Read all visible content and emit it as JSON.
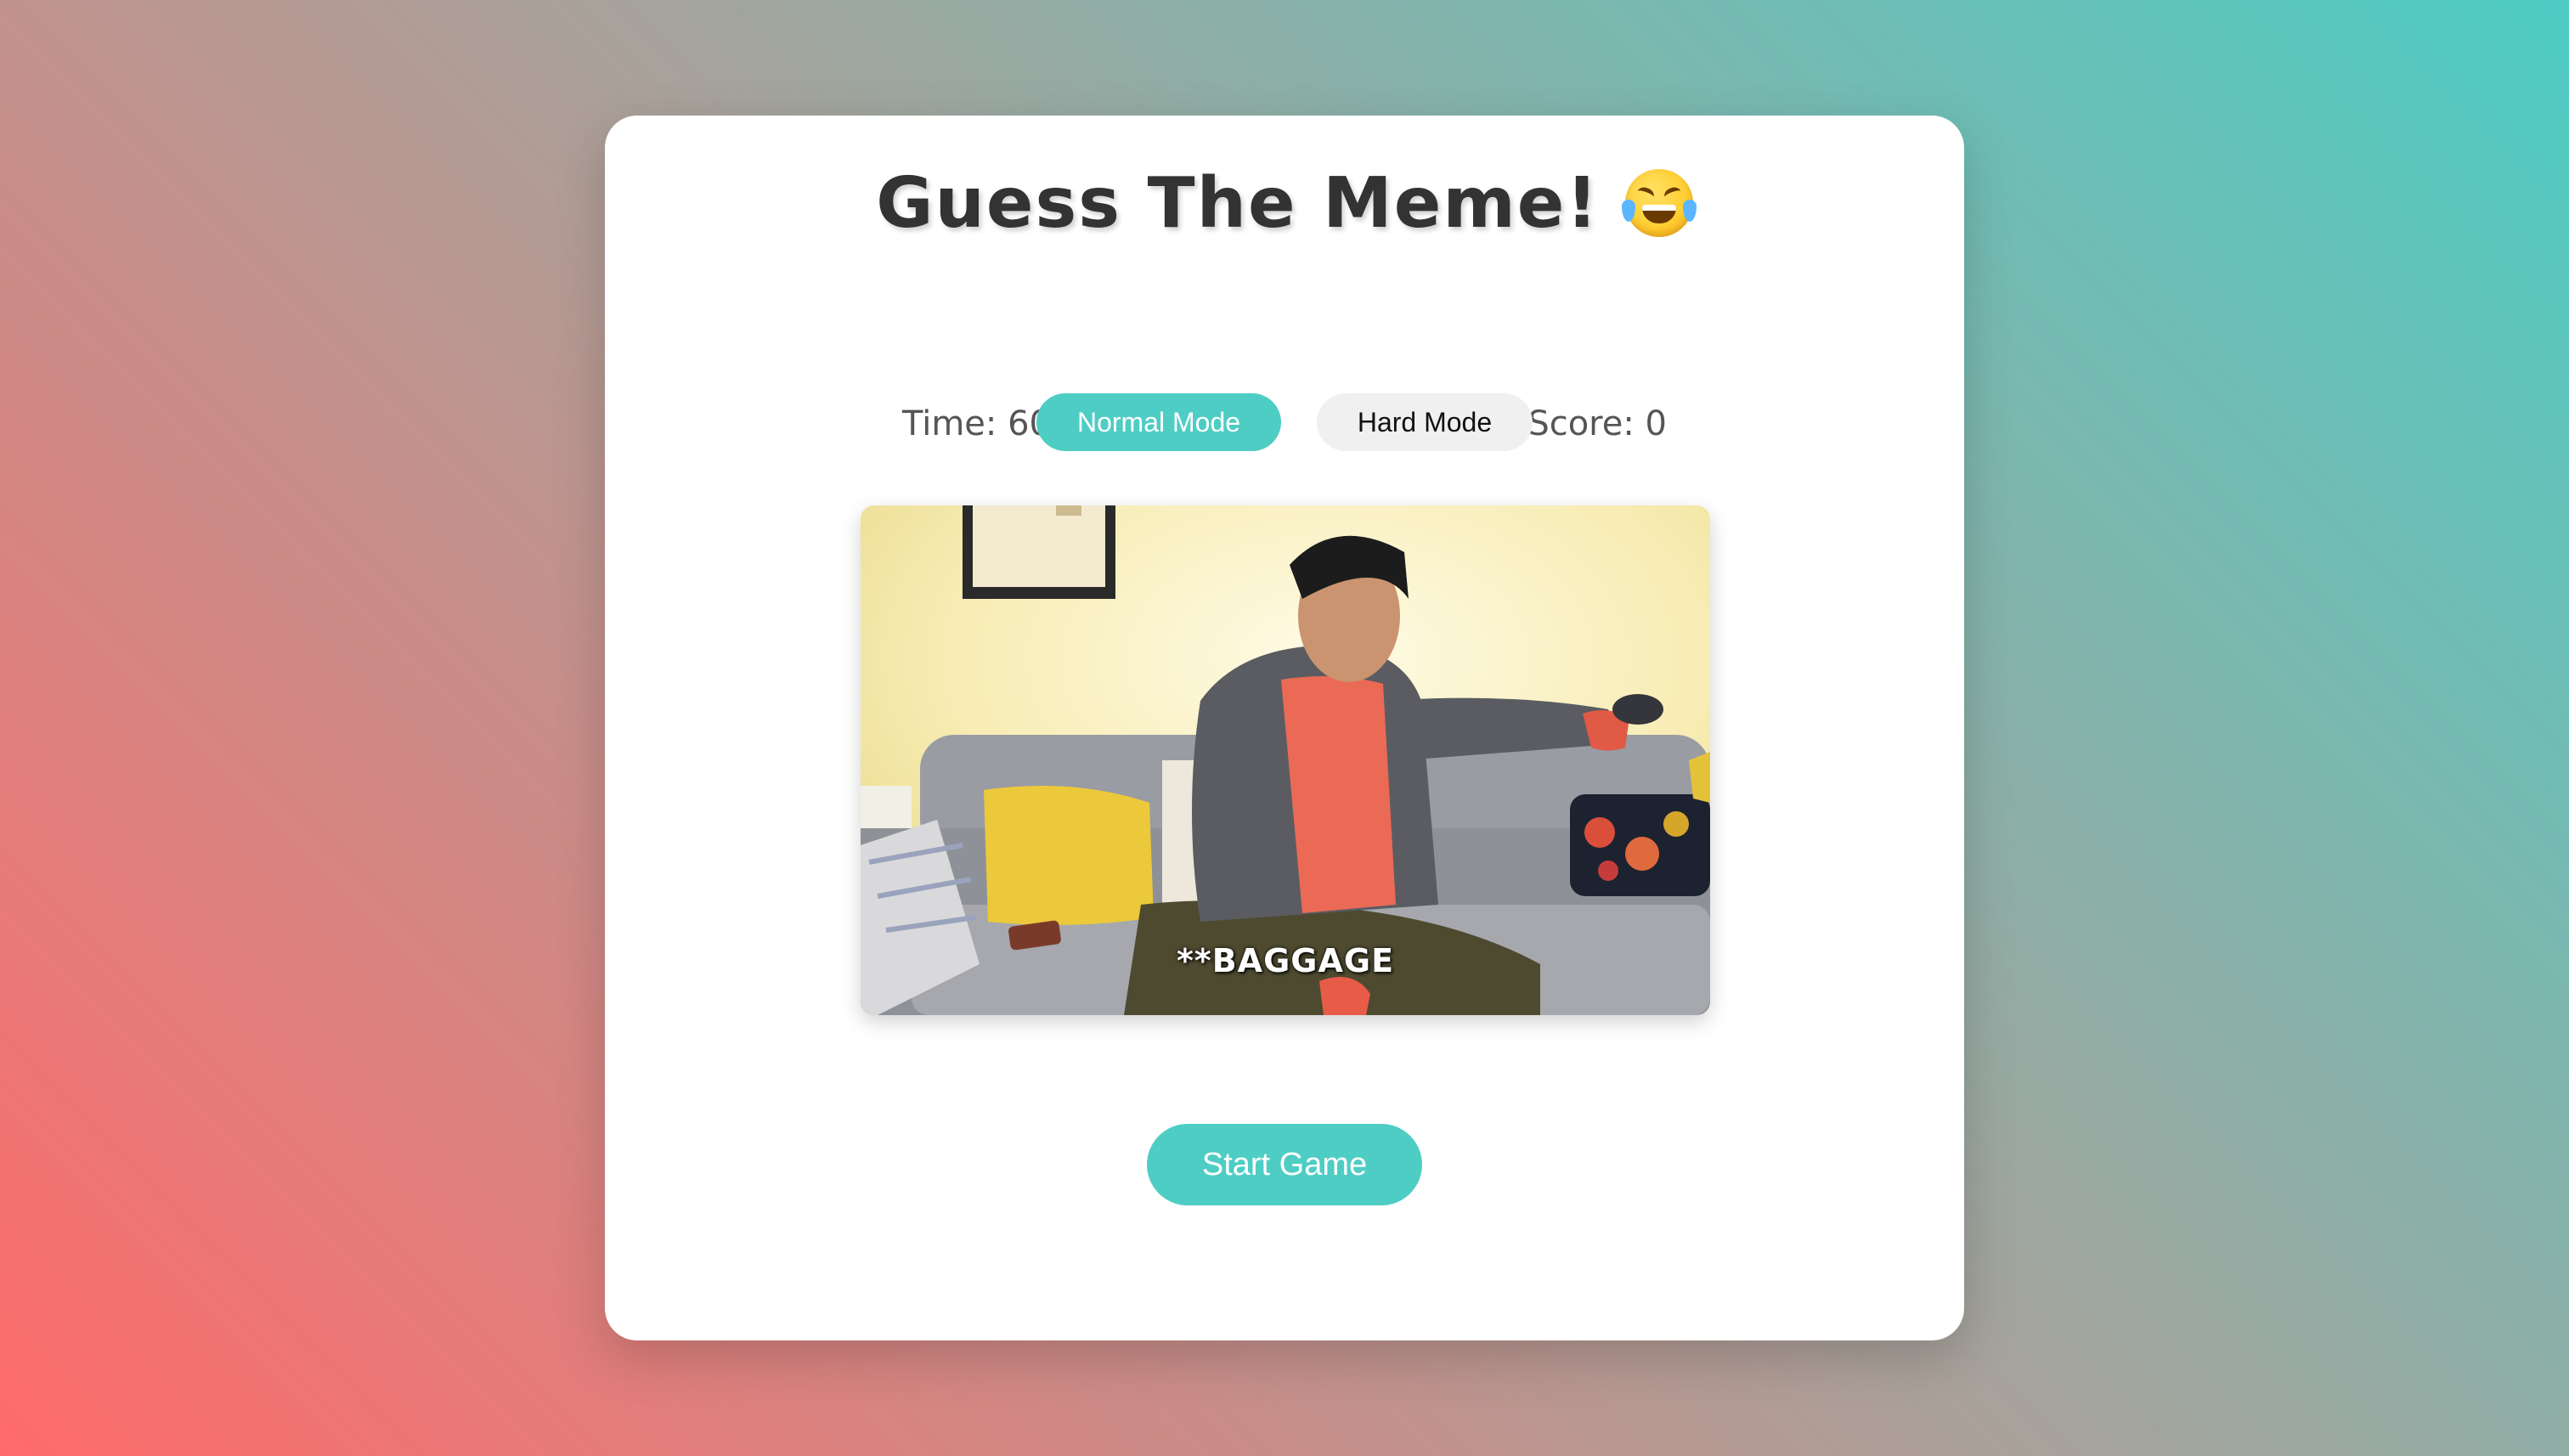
{
  "game": {
    "title": "Guess The Meme!",
    "title_emoji": "face-with-tears-of-joy",
    "time_label": "Time: 60s",
    "score_label": "Score: 0"
  },
  "modes": {
    "normal_label": "Normal Mode",
    "hard_label": "Hard Mode",
    "active": "normal"
  },
  "meme": {
    "caption": "**BAGGAGE"
  },
  "actions": {
    "start_label": "Start Game"
  },
  "colors": {
    "accent": "#4ecdc4",
    "gradient_start": "#ff6b6b",
    "gradient_end": "#4ecdc4",
    "card": "#ffffff",
    "inactive_button": "#f0f0f0",
    "title_text": "#333333"
  }
}
